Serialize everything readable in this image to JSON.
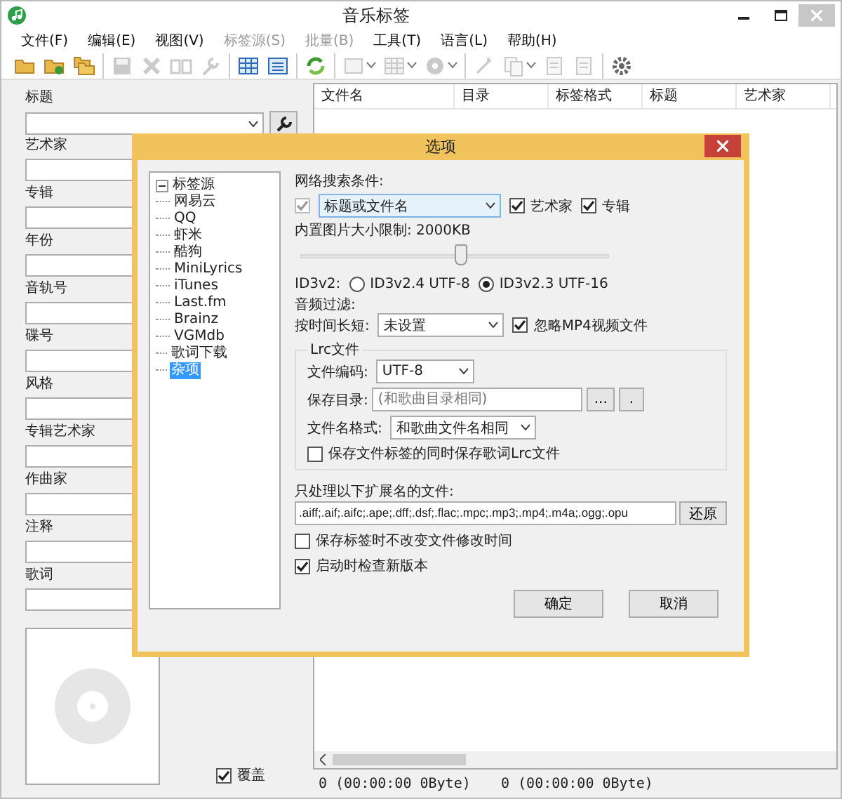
{
  "window": {
    "title": "音乐标签"
  },
  "menu": [
    {
      "label": "文件(F)",
      "disabled": false
    },
    {
      "label": "编辑(E)",
      "disabled": false
    },
    {
      "label": "视图(V)",
      "disabled": false
    },
    {
      "label": "标签源(S)",
      "disabled": true
    },
    {
      "label": "批量(B)",
      "disabled": true
    },
    {
      "label": "工具(T)",
      "disabled": false
    },
    {
      "label": "语言(L)",
      "disabled": false
    },
    {
      "label": "帮助(H)",
      "disabled": false
    }
  ],
  "toolbar": [
    {
      "items": [
        {
          "kind": "folder",
          "disabled": false,
          "dropdown": false
        },
        {
          "kind": "folder-plus",
          "disabled": false,
          "dropdown": false
        },
        {
          "kind": "folders",
          "disabled": false,
          "dropdown": false
        }
      ]
    },
    {
      "items": [
        {
          "kind": "save",
          "disabled": true,
          "dropdown": false
        },
        {
          "kind": "delete",
          "disabled": true,
          "dropdown": false
        },
        {
          "kind": "book",
          "disabled": true,
          "dropdown": false
        },
        {
          "kind": "wrench",
          "disabled": true,
          "dropdown": false
        }
      ]
    },
    {
      "items": [
        {
          "kind": "grid",
          "disabled": false,
          "dropdown": false
        },
        {
          "kind": "list",
          "disabled": false,
          "dropdown": false
        }
      ]
    },
    {
      "items": [
        {
          "kind": "refresh",
          "disabled": false,
          "dropdown": false
        }
      ]
    },
    {
      "items": [
        {
          "kind": "image",
          "disabled": true,
          "dropdown": true
        },
        {
          "kind": "grid",
          "disabled": true,
          "dropdown": true
        },
        {
          "kind": "disc",
          "disabled": true,
          "dropdown": true
        }
      ]
    },
    {
      "items": [
        {
          "kind": "wand",
          "disabled": true,
          "dropdown": false
        },
        {
          "kind": "copy",
          "disabled": true,
          "dropdown": true
        },
        {
          "kind": "doc",
          "disabled": true,
          "dropdown": false
        },
        {
          "kind": "doc",
          "disabled": true,
          "dropdown": false
        }
      ]
    },
    {
      "items": [
        {
          "kind": "gear",
          "disabled": false,
          "dropdown": false
        }
      ]
    }
  ],
  "tag_panel": {
    "fields": [
      {
        "label": "标题",
        "kind": "combo"
      },
      {
        "label": "艺术家",
        "kind": "text"
      },
      {
        "label": "专辑",
        "kind": "text"
      },
      {
        "label": "年份",
        "kind": "text"
      },
      {
        "label": "音轨号",
        "kind": "text"
      },
      {
        "label": "碟号",
        "kind": "text"
      },
      {
        "label": "风格",
        "kind": "text"
      },
      {
        "label": "专辑艺术家",
        "kind": "text"
      },
      {
        "label": "作曲家",
        "kind": "text"
      },
      {
        "label": "注释",
        "kind": "text"
      },
      {
        "label": "歌词",
        "kind": "text"
      }
    ],
    "overwrite": {
      "label": "覆盖",
      "checked": true
    }
  },
  "file_list": {
    "columns": [
      "文件名",
      "目录",
      "标签格式",
      "标题",
      "艺术家"
    ],
    "status": [
      "0 (00:00:00 0Byte)",
      "0 (00:00:00 0Byte)"
    ]
  },
  "dialog": {
    "title": "选项",
    "tree": [
      {
        "label": "标签源",
        "expanded": true,
        "selected": false,
        "children": [
          {
            "label": "网易云",
            "selected": false
          },
          {
            "label": "QQ",
            "selected": false
          },
          {
            "label": "虾米",
            "selected": false
          },
          {
            "label": "酷狗",
            "selected": false
          },
          {
            "label": "MiniLyrics",
            "selected": false
          },
          {
            "label": "iTunes",
            "selected": false
          },
          {
            "label": "Last.fm",
            "selected": false
          },
          {
            "label": "Brainz",
            "selected": false
          },
          {
            "label": "VGMdb",
            "selected": false
          }
        ]
      },
      {
        "label": "歌词下载",
        "selected": false
      },
      {
        "label": "杂项",
        "selected": true
      }
    ],
    "search": {
      "label": "网络搜索条件:",
      "field_checked": true,
      "field_value": "标题或文件名",
      "options": [
        {
          "label": "艺术家",
          "checked": true
        },
        {
          "label": "专辑",
          "checked": true
        }
      ]
    },
    "image_limit": {
      "label": "内置图片大小限制: 2000KB",
      "level": 0.52
    },
    "id3v2": {
      "label": "ID3v2:",
      "options": [
        {
          "label": "ID3v2.4 UTF-8",
          "selected": false
        },
        {
          "label": "ID3v2.3 UTF-16",
          "selected": true
        }
      ]
    },
    "audio_filter": {
      "label": "音频过滤:",
      "duration_label": "按时间长短:",
      "duration_value": "未设置",
      "ignore_mp4": {
        "label": "忽略MP4视频文件",
        "checked": true
      }
    },
    "lrc": {
      "legend": "Lrc文件",
      "encoding_label": "文件编码:",
      "encoding_value": "UTF-8",
      "dir_label": "保存目录:",
      "dir_placeholder": "(和歌曲目录相同)",
      "browse_buttons": [
        "...",
        "."
      ],
      "name_label": "文件名格式:",
      "name_value": "和歌曲文件名相同",
      "save_with_tags": {
        "label": "保存文件标签的同时保存歌词Lrc文件",
        "checked": false
      }
    },
    "extensions": {
      "label": "只处理以下扩展名的文件:",
      "value": ".aiff;.aif;.aifc;.ape;.dff;.dsf;.flac;.mpc;.mp3;.mp4;.m4a;.ogg;.opu",
      "button": "还原"
    },
    "options": [
      {
        "label": "保存标签时不改变文件修改时间",
        "checked": false
      },
      {
        "label": "启动时检查新版本",
        "checked": true
      }
    ],
    "buttons": [
      "确定",
      "取消"
    ]
  }
}
